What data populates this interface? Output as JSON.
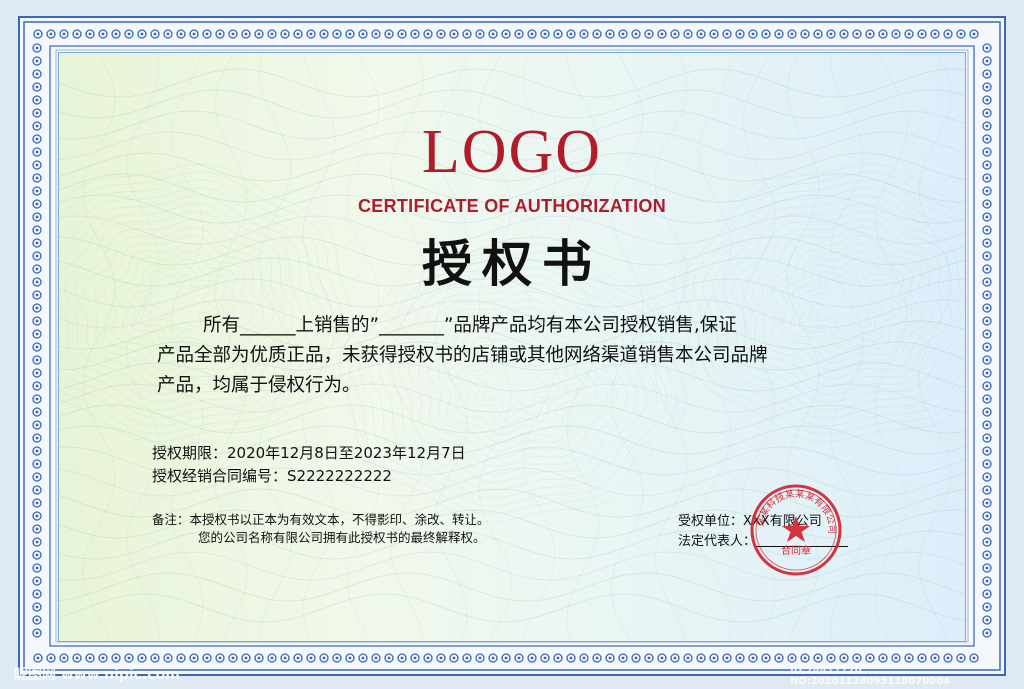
{
  "certificate": {
    "logo": "LOGO",
    "subtitle": "CERTIFICATE OF AUTHORIZATION",
    "title": "授权书",
    "body_lines": [
      "所有______上销售的”_______”品牌产品均有本公司授权销售,保证",
      "产品全部为优质正品，未获得授权书的店铺或其他网络渠道销售本公司品牌",
      "产品，均属于侵权行为。"
    ],
    "period": "授权期限：2020年12月8日至2023年12月7日",
    "contract": "授权经销合同编号：S2222222222",
    "note_line1": "备注：本授权书以正本为有效文本，不得影印、涂改、转让。",
    "note_line2": "您的公司名称有限公司拥有此授权书的最终解释权。",
    "grantor_unit": "受权单位：XXX有限公司",
    "legal_rep": "法定代表人：",
    "stamp_ring": "某某科技某某某有限公司",
    "stamp_label": "合同章"
  },
  "watermark": {
    "left": "昵图网 www.nipic.com",
    "right": "ID:24411120 NO:20201128095118070004"
  },
  "colors": {
    "border_blue": "#3b67b5",
    "logo_red": "#b01c2a",
    "stamp_red": "#d11f2c",
    "text": "#111111"
  }
}
